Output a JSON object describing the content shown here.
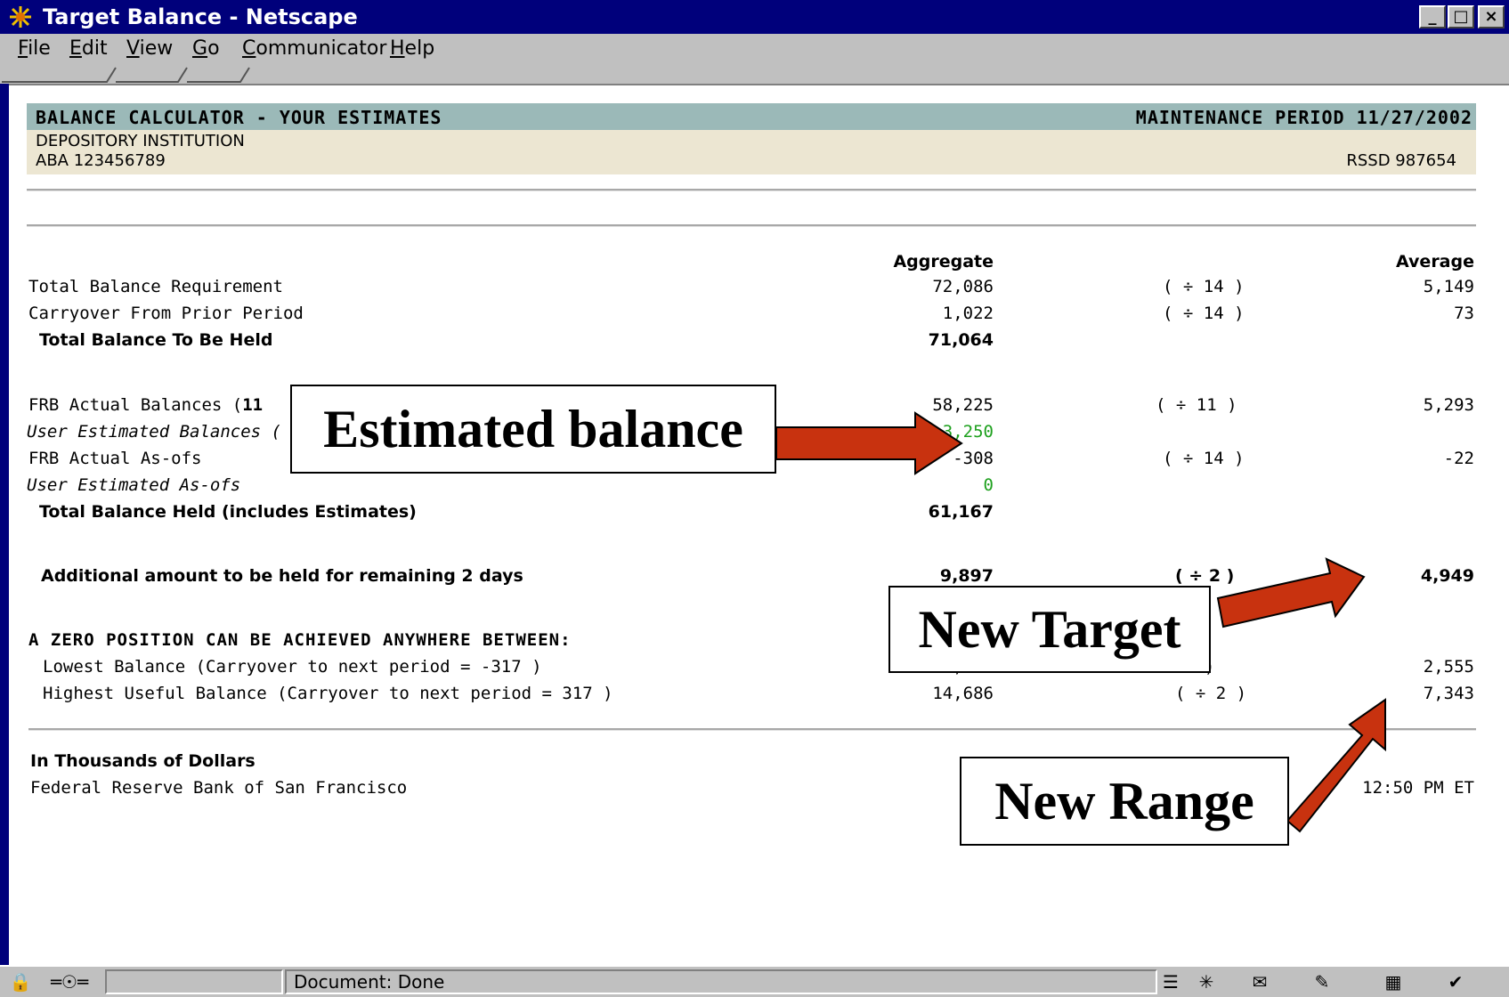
{
  "window": {
    "title": "Target Balance - Netscape",
    "controls": [
      "_",
      "□",
      "×"
    ]
  },
  "menu": {
    "items": [
      {
        "label": "File",
        "key": "F",
        "rest": "ile"
      },
      {
        "label": "Edit",
        "key": "E",
        "rest": "dit"
      },
      {
        "label": "View",
        "key": "V",
        "rest": "iew"
      },
      {
        "label": "Go",
        "key": "G",
        "rest": "o"
      },
      {
        "label": "Communicator",
        "key": "C",
        "rest": "ommunicator"
      },
      {
        "label": "Help",
        "key": "H",
        "rest": "elp"
      }
    ]
  },
  "header": {
    "title": "BALANCE CALCULATOR - YOUR ESTIMATES",
    "period": "MAINTENANCE PERIOD 11/27/2002",
    "institution": "DEPOSITORY INSTITUTION",
    "aba": "ABA 123456789",
    "rssd": "RSSD 987654"
  },
  "columns": {
    "aggregate": "Aggregate",
    "average": "Average"
  },
  "rows": {
    "total_req": {
      "label": "Total Balance Requirement",
      "aggregate": "72,086",
      "divisor": "( ÷ 14 )",
      "average": "5,149"
    },
    "carryover": {
      "label": "Carryover From Prior Period",
      "aggregate": "1,022",
      "divisor": "( ÷ 14 )",
      "average": "73"
    },
    "to_be_held": {
      "label": "Total Balance To Be Held",
      "aggregate": "71,064"
    },
    "frb_actual": {
      "label_prefix": "FRB Actual Balances (",
      "label_bold": "11",
      "aggregate": "58,225",
      "divisor": "( ÷ 11 )",
      "average": "5,293"
    },
    "user_est": {
      "label": "User Estimated Balances (",
      "aggregate": "3,250"
    },
    "frb_asofs": {
      "label": "FRB Actual As-ofs",
      "aggregate": "-308",
      "divisor": "( ÷ 14 )",
      "average": "-22"
    },
    "user_asofs": {
      "label": "User Estimated As-ofs",
      "aggregate": "0"
    },
    "total_held": {
      "label": "Total Balance Held (includes Estimates)",
      "aggregate": "61,167"
    },
    "additional": {
      "label": "Additional amount to be held for remaining 2 days",
      "aggregate": "9,897",
      "divisor": "( ÷ 2 )",
      "average": "4,949"
    },
    "zero_heading": "A ZERO POSITION CAN BE ACHIEVED ANYWHERE BETWEEN:",
    "lowest": {
      "label": "Lowest Balance (Carryover to next period = -317 )",
      "aggregate_partial": "5,110",
      "divisor": "2 )",
      "average": "2,555"
    },
    "highest": {
      "label": "Highest Useful Balance (Carryover to next period = 317 )",
      "aggregate": "14,686",
      "divisor": "( ÷ 2 )",
      "average": "7,343"
    }
  },
  "footer": {
    "units": "In Thousands of Dollars",
    "bank": "Federal Reserve Bank of San Francisco",
    "time_partial": "12:50 PM ET"
  },
  "callouts": {
    "estimated": "Estimated balance",
    "target": "New Target",
    "range": "New Range"
  },
  "status": {
    "text": "Document: Done"
  },
  "colors": {
    "titlebar": "#00007b",
    "chrome": "#c0c0c0",
    "header_band": "#9bb9b8",
    "inst_band": "#ece6d2",
    "estimate_green": "#1ea01e",
    "arrow": "#c8320f"
  },
  "icons": [
    "netscape-logo-icon",
    "lock-icon",
    "connection-icon",
    "component-icon",
    "mail-icon",
    "discussion-icon",
    "composer-icon",
    "security-icon"
  ]
}
